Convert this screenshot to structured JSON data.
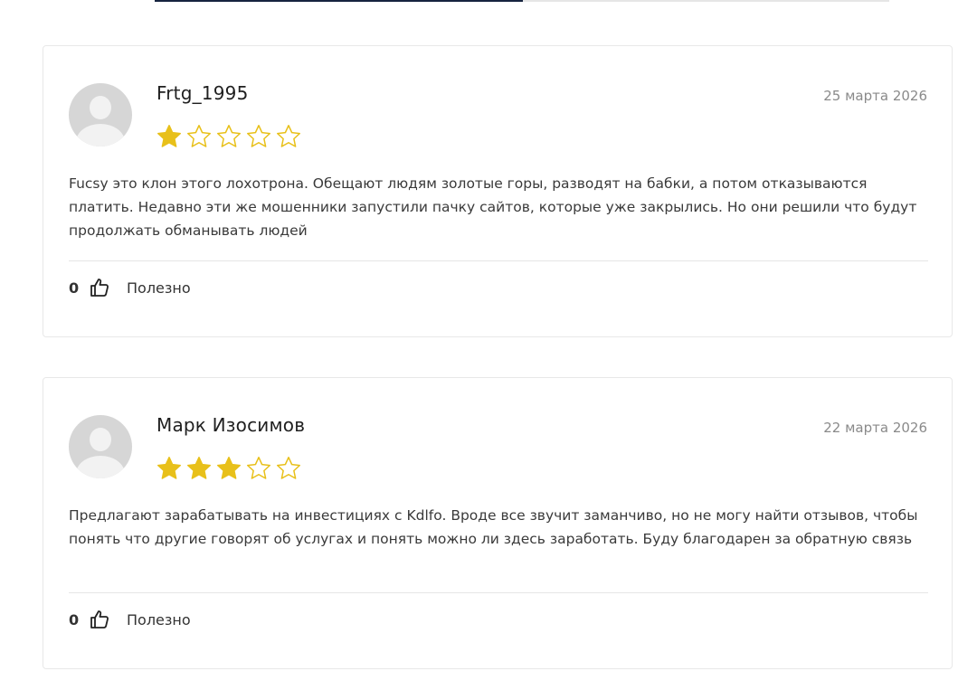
{
  "colors": {
    "star_filled": "#e8c01a",
    "star_empty_stroke": "#e8c01a",
    "tab_active": "#16233f"
  },
  "reviews": [
    {
      "author": "Frtg_1995",
      "date": "25 марта 2026",
      "rating": 1,
      "text": "Fucsy это клон этого лохотрона. Обещают людям золотые горы, разводят на бабки, а потом отказываются платить. Недавно эти же мошенники запустили пачку сайтов, которые уже закрылись. Но они решили что будут продолжать обманывать людей",
      "likes": "0",
      "helpful_label": "Полезно"
    },
    {
      "author": "Марк Изосимов",
      "date": "22 марта 2026",
      "rating": 3,
      "text": "Предлагают зарабатывать на инвестициях с Kdlfo. Вроде все звучит заманчиво, но не могу найти отзывов, чтобы понять что другие говорят об услугах и понять можно ли здесь заработать. Буду благодарен за обратную связь",
      "likes": "0",
      "helpful_label": "Полезно"
    }
  ]
}
